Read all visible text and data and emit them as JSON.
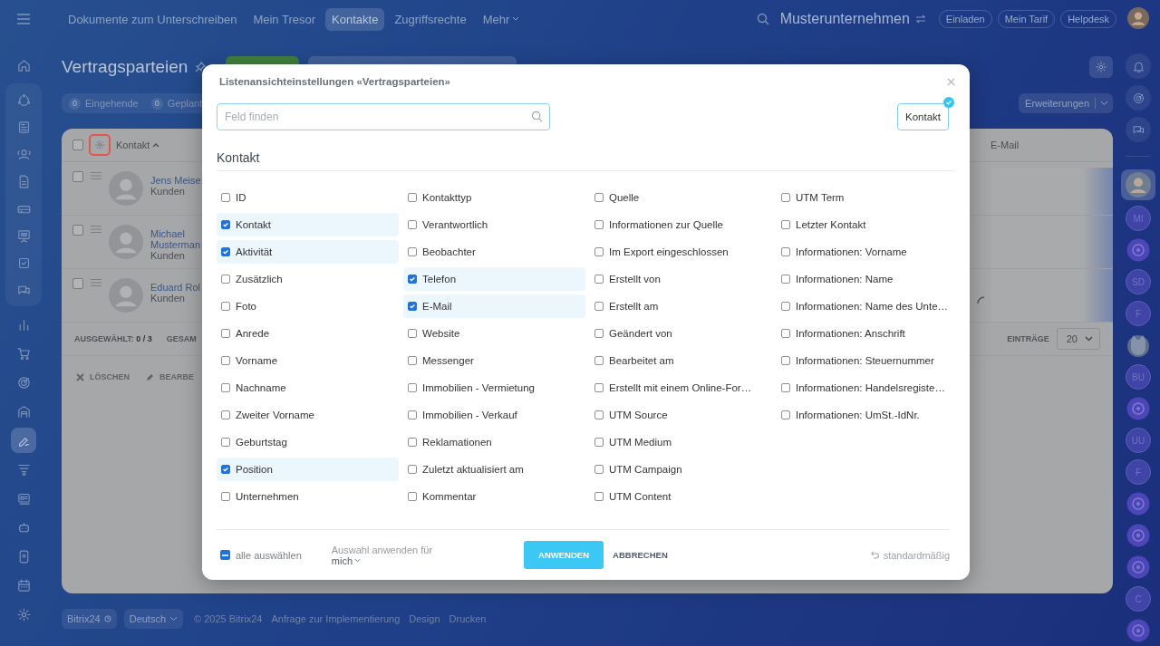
{
  "topbar": {
    "nav": [
      {
        "label": "Dokumente zum Unterschreiben",
        "selected": false
      },
      {
        "label": "Mein Tresor",
        "selected": false
      },
      {
        "label": "Kontakte",
        "selected": true
      },
      {
        "label": "Zugriffsrechte",
        "selected": false
      },
      {
        "label": "Mehr",
        "selected": false
      }
    ],
    "company": "Musterunternehmen",
    "buttons": [
      "Einladen",
      "Mein Tarif",
      "Helpdesk"
    ]
  },
  "sidebar": {
    "top": [
      {
        "kind": "home",
        "selected": false
      }
    ],
    "group": [
      {
        "kind": "orbit",
        "selected": false
      },
      {
        "kind": "news",
        "selected": false
      },
      {
        "kind": "people",
        "selected": false
      },
      {
        "kind": "doc",
        "selected": false
      },
      {
        "kind": "drive",
        "selected": false
      },
      {
        "kind": "board",
        "selected": false
      },
      {
        "kind": "task",
        "selected": false
      },
      {
        "kind": "chat",
        "selected": false
      }
    ],
    "rest": [
      {
        "kind": "bars",
        "selected": false
      },
      {
        "kind": "cart",
        "selected": false
      },
      {
        "kind": "target",
        "selected": false
      },
      {
        "kind": "garage",
        "selected": false
      },
      {
        "kind": "sign",
        "selected": true
      },
      {
        "kind": "funnel",
        "selected": false
      },
      {
        "kind": "card",
        "selected": false
      },
      {
        "kind": "robot",
        "selected": false
      },
      {
        "kind": "device",
        "selected": false
      },
      {
        "kind": "calendar",
        "selected": false
      },
      {
        "kind": "gear",
        "selected": false
      }
    ]
  },
  "page": {
    "title": "Vertragsparteien",
    "counters": [
      {
        "count": "0",
        "label": "Eingehende"
      },
      {
        "count": "0",
        "label": "Geplant"
      }
    ],
    "extensions": "Erweiterungen"
  },
  "grid": {
    "columns": [
      "Kontakt",
      "E-Mail"
    ],
    "header_checked": false,
    "rows": [
      {
        "name": "Jens Meise",
        "group": "Kunden",
        "phone": false,
        "checked": false
      },
      {
        "name": "Michael Musterman",
        "group": "Kunden",
        "phone": false,
        "checked": false
      },
      {
        "name": "Eduard Rol",
        "group": "Kunden",
        "phone": true,
        "checked": false
      }
    ],
    "selected_info": "AUSGEWÄHLT: **0 / 3**",
    "total": "GESAM",
    "per_page_label": "EINTRÄGE",
    "per_page": "20",
    "actions": [
      {
        "kind": "delete",
        "label": "LÖSCHEN"
      },
      {
        "kind": "edit",
        "label": "BEARBE"
      }
    ]
  },
  "rightbar_top": [
    {
      "kind": "bell",
      "selected": false
    },
    {
      "kind": "target",
      "selected": false
    },
    {
      "kind": "chat",
      "selected": false
    }
  ],
  "rightbar": [
    {
      "kind": "avatar",
      "selected": true
    },
    {
      "kind": "initials",
      "text": "MI",
      "selected": false
    },
    {
      "kind": "round",
      "selected": false
    },
    {
      "kind": "initials",
      "text": "SD",
      "selected": false
    },
    {
      "kind": "initials",
      "text": "F",
      "selected": false
    },
    {
      "kind": "pet",
      "selected": false
    },
    {
      "kind": "initials",
      "text": "BU",
      "selected": false
    },
    {
      "kind": "round",
      "selected": false
    },
    {
      "kind": "initials",
      "text": "UU",
      "selected": false
    },
    {
      "kind": "initials",
      "text": "F",
      "selected": false
    },
    {
      "kind": "round",
      "selected": false
    },
    {
      "kind": "round",
      "selected": false
    },
    {
      "kind": "round",
      "selected": false
    },
    {
      "kind": "initials",
      "text": "C",
      "selected": false
    },
    {
      "kind": "round",
      "selected": false
    }
  ],
  "footer": {
    "brand": "Bitrix24",
    "language": "Deutsch",
    "links": [
      "© 2025 Bitrix24",
      "Anfrage zur Implementierung",
      "Design",
      "Drucken"
    ]
  },
  "dialog": {
    "title": "Listenansichteinstellungen «Vertragsparteien»",
    "search": {
      "placeholder": "Feld finden"
    },
    "chips": [
      {
        "label": "Kontakt",
        "selected": true
      }
    ],
    "section": "Kontakt",
    "fields": [
      {
        "label": "ID",
        "checked": false
      },
      {
        "label": "Kontakt",
        "checked": true
      },
      {
        "label": "Aktivität",
        "checked": true
      },
      {
        "label": "Zusätzlich",
        "checked": false
      },
      {
        "label": "Foto",
        "checked": false
      },
      {
        "label": "Anrede",
        "checked": false
      },
      {
        "label": "Vorname",
        "checked": false
      },
      {
        "label": "Nachname",
        "checked": false
      },
      {
        "label": "Zweiter Vorname",
        "checked": false
      },
      {
        "label": "Geburtstag",
        "checked": false
      },
      {
        "label": "Position",
        "checked": true
      },
      {
        "label": "Unternehmen",
        "checked": false
      },
      {
        "label": "Kontakttyp",
        "checked": false
      },
      {
        "label": "Verantwortlich",
        "checked": false
      },
      {
        "label": "Beobachter",
        "checked": false
      },
      {
        "label": "Telefon",
        "checked": true
      },
      {
        "label": "E-Mail",
        "checked": true
      },
      {
        "label": "Website",
        "checked": false
      },
      {
        "label": "Messenger",
        "checked": false
      },
      {
        "label": "Immobilien - Vermietung",
        "checked": false
      },
      {
        "label": "Immobilien - Verkauf",
        "checked": false
      },
      {
        "label": "Reklamationen",
        "checked": false
      },
      {
        "label": "Zuletzt aktualisiert am",
        "checked": false
      },
      {
        "label": "Kommentar",
        "checked": false
      },
      {
        "label": "Quelle",
        "checked": false
      },
      {
        "label": "Informationen zur Quelle",
        "checked": false
      },
      {
        "label": "Im Export eingeschlossen",
        "checked": false
      },
      {
        "label": "Erstellt von",
        "checked": false
      },
      {
        "label": "Erstellt am",
        "checked": false
      },
      {
        "label": "Geändert von",
        "checked": false
      },
      {
        "label": "Bearbeitet am",
        "checked": false
      },
      {
        "label": "Erstellt mit einem Online-For…",
        "checked": false
      },
      {
        "label": "UTM Source",
        "checked": false
      },
      {
        "label": "UTM Medium",
        "checked": false
      },
      {
        "label": "UTM Campaign",
        "checked": false
      },
      {
        "label": "UTM Content",
        "checked": false
      },
      {
        "label": "UTM Term",
        "checked": false
      },
      {
        "label": "Letzter Kontakt",
        "checked": false
      },
      {
        "label": "Informationen: Vorname",
        "checked": false
      },
      {
        "label": "Informationen: Name",
        "checked": false
      },
      {
        "label": "Informationen: Name des Unte…",
        "checked": false
      },
      {
        "label": "Informationen: Anschrift",
        "checked": false
      },
      {
        "label": "Informationen: Steuernummer",
        "checked": false
      },
      {
        "label": "Informationen: Handelsregiste…",
        "checked": false
      },
      {
        "label": "Informationen: UmSt.-IdNr.",
        "checked": false
      }
    ],
    "select_all": {
      "label": "alle auswählen",
      "indeterminate": true
    },
    "apply_for": {
      "label": "Auswahl anwenden für",
      "value": "mich"
    },
    "apply": "ANWENDEN",
    "cancel": "ABBRECHEN",
    "reset": "standardmäßig"
  }
}
